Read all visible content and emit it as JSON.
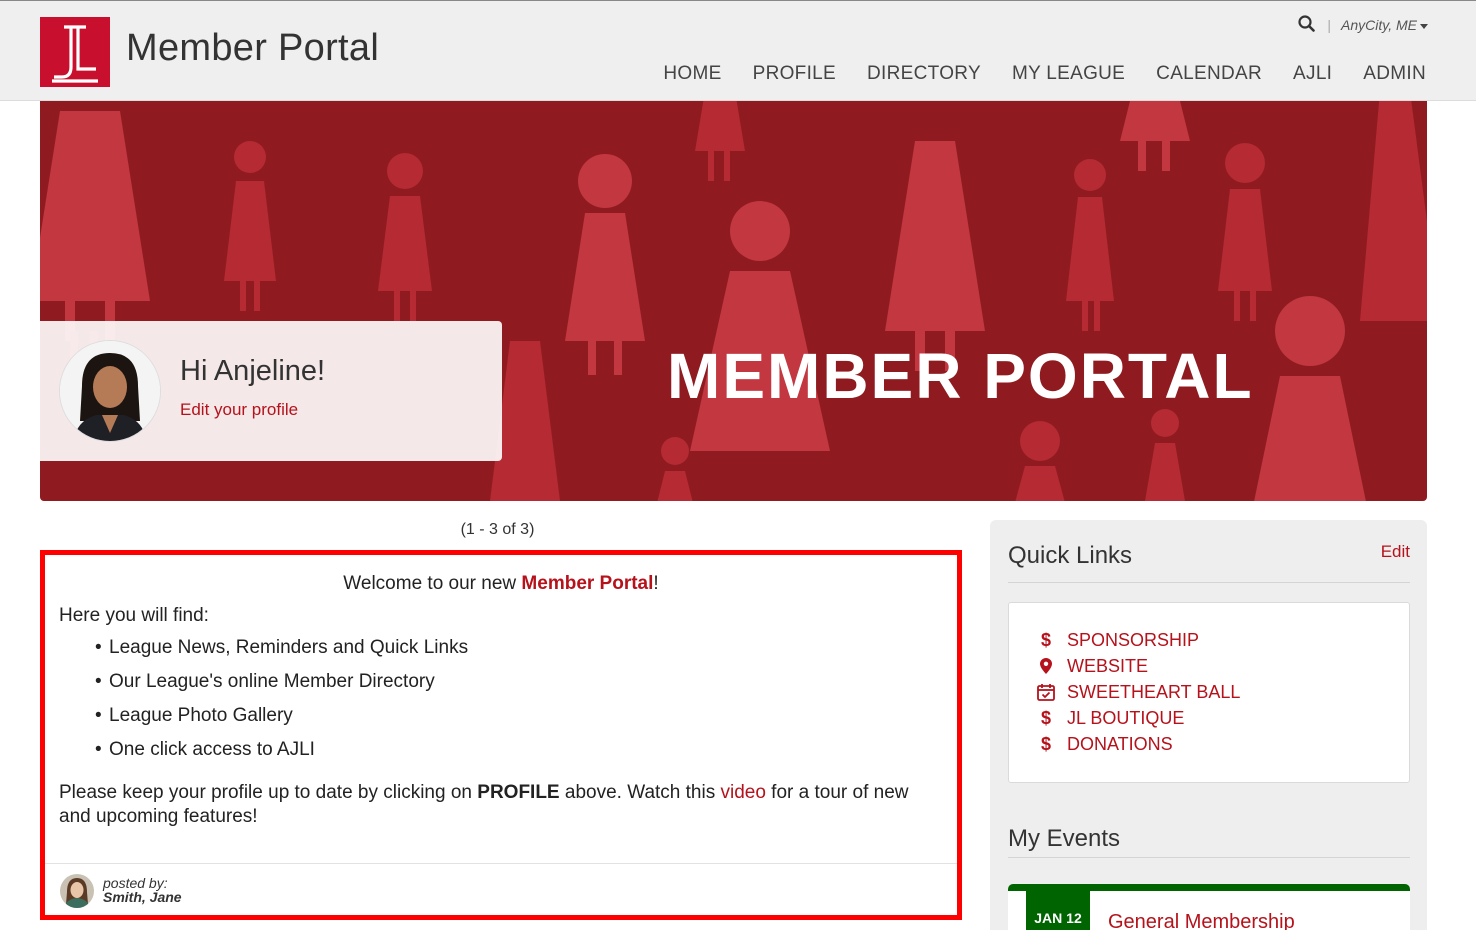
{
  "header": {
    "logo_icon": "jl-logo-icon",
    "site_title": "Member Portal",
    "search_icon": "search-icon",
    "location": "AnyCity, ME",
    "nav": [
      {
        "label": "HOME"
      },
      {
        "label": "PROFILE"
      },
      {
        "label": "DIRECTORY"
      },
      {
        "label": "MY LEAGUE"
      },
      {
        "label": "CALENDAR"
      },
      {
        "label": "AJLI"
      },
      {
        "label": "ADMIN"
      }
    ]
  },
  "hero": {
    "title": "MEMBER PORTAL",
    "greeting": "Hi Anjeline!",
    "edit_profile": "Edit your profile"
  },
  "pager": "(1 - 3 of 3)",
  "post": {
    "welcome_pre": "Welcome to our new ",
    "welcome_brand": "Member Portal",
    "welcome_post": "!",
    "find_intro": "Here you will find:",
    "items": [
      "League News, Reminders and Quick Links",
      "Our League's online Member Directory",
      "League Photo Gallery",
      "One click access to AJLI"
    ],
    "para_1": "Please keep your profile up to date by clicking on ",
    "para_bold": "PROFILE",
    "para_2": " above. Watch this ",
    "para_link": "video",
    "para_3": " for a tour of new and upcoming features!",
    "posted_by_label": "posted by:",
    "posted_by_name": "Smith, Jane"
  },
  "quick_links": {
    "title": "Quick Links",
    "edit": "Edit",
    "items": [
      {
        "icon": "dollar-icon",
        "glyph": "$",
        "label": "SPONSORSHIP"
      },
      {
        "icon": "map-pin-icon",
        "glyph": "",
        "label": "WEBSITE"
      },
      {
        "icon": "calendar-check-icon",
        "glyph": "",
        "label": "SWEETHEART BALL"
      },
      {
        "icon": "dollar-icon",
        "glyph": "$",
        "label": "JL BOUTIQUE"
      },
      {
        "icon": "dollar-icon",
        "glyph": "$",
        "label": "DONATIONS"
      }
    ]
  },
  "events": {
    "title": "My Events",
    "items": [
      {
        "date": "JAN 12",
        "name": "General Membership"
      }
    ]
  },
  "colors": {
    "brand_red": "#b5121b",
    "hero_bg": "#8f1b21",
    "event_green": "#006400",
    "highlight_border": "#ff0000"
  }
}
